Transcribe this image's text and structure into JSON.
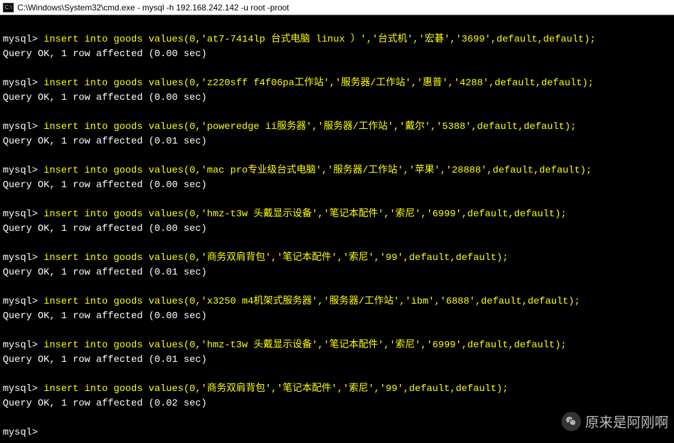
{
  "window": {
    "title": "C:\\Windows\\System32\\cmd.exe - mysql   -h 192.168.242.142 -u root -proot"
  },
  "prompt": "mysql>",
  "entries": [
    {
      "cmd": "insert into goods values(0,'at7-7414lp 台式电脑 linux ）','台式机','宏碁','3699',default,default);",
      "result": "Query OK, 1 row affected (0.00 sec)"
    },
    {
      "cmd": "insert into goods values(0,'z220sff f4f06pa工作站','服务器/工作站','惠普','4288',default,default);",
      "result": "Query OK, 1 row affected (0.00 sec)"
    },
    {
      "cmd": "insert into goods values(0,'poweredge ii服务器','服务器/工作站','戴尔','5388',default,default);",
      "result": "Query OK, 1 row affected (0.01 sec)"
    },
    {
      "cmd": "insert into goods values(0,'mac pro专业级台式电脑','服务器/工作站','苹果','28888',default,default);",
      "result": "Query OK, 1 row affected (0.00 sec)"
    },
    {
      "cmd": "insert into goods values(0,'hmz-t3w 头戴显示设备','笔记本配件','索尼','6999',default,default);",
      "result": "Query OK, 1 row affected (0.00 sec)"
    },
    {
      "cmd": "insert into goods values(0,'商务双肩背包','笔记本配件','索尼','99',default,default);",
      "result": "Query OK, 1 row affected (0.01 sec)"
    },
    {
      "cmd": "insert into goods values(0,'x3250 m4机架式服务器','服务器/工作站','ibm','6888',default,default);",
      "result": "Query OK, 1 row affected (0.00 sec)"
    },
    {
      "cmd": "insert into goods values(0,'hmz-t3w 头戴显示设备','笔记本配件','索尼','6999',default,default);",
      "result": "Query OK, 1 row affected (0.01 sec)"
    },
    {
      "cmd": "insert into goods values(0,'商务双肩背包','笔记本配件','索尼','99',default,default);",
      "result": "Query OK, 1 row affected (0.02 sec)"
    }
  ],
  "final_prompt": "mysql>",
  "watermark": {
    "text": "原来是阿刚啊"
  }
}
